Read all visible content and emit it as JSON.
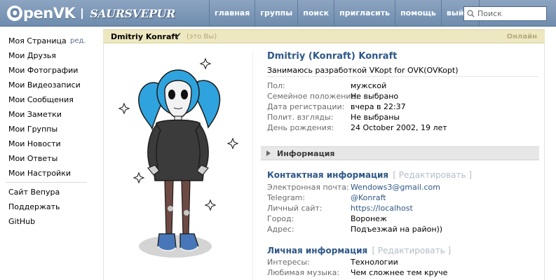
{
  "header": {
    "logo_text": "penVK",
    "logo_o": "O",
    "brand": "SAURSVEPUR",
    "nav": [
      "главная",
      "группы",
      "поиск",
      "пригласить",
      "помощь",
      "выйти"
    ],
    "search_placeholder": "Поиск"
  },
  "sidebar": {
    "items": [
      "Моя Страница",
      "Мои Друзья",
      "Мои Фотографии",
      "Мои Видеозаписи",
      "Мои Сообщения",
      "Мои Заметки",
      "Мои Группы",
      "Мои Новости",
      "Мои Ответы",
      "Мои Настройки"
    ],
    "edit_label": "ред.",
    "extra": [
      "Сайт Вепура",
      "Поддержать",
      "GitHub"
    ]
  },
  "page_header": {
    "name": "Dmitriy Konraft",
    "check": "✔",
    "you": "(это Вы)",
    "online": "Онлайн"
  },
  "profile": {
    "full_name": "Dmitriy (Konraft) Konraft",
    "status": "Занимаюсь разработкой VKopt for OVK(OVKopt)",
    "basic": [
      {
        "label": "Пол:",
        "value": "мужской"
      },
      {
        "label": "Семейное положение:",
        "value": "Не выбрано"
      },
      {
        "label": "Дата регистрации:",
        "value": "вчера в 22:37"
      },
      {
        "label": "Полит. взгляды:",
        "value": "Не выбраны"
      },
      {
        "label": "День рождения:",
        "value": "24 October 2002, 19 лет"
      }
    ],
    "info_section": "Информация",
    "contact_title": "Контактная информация",
    "edit_link": "[ Редактировать ]",
    "contact": [
      {
        "label": "Электронная почта:",
        "value": "Wendows3@gmail.com"
      },
      {
        "label": "Telegram:",
        "value": "@Konraft"
      },
      {
        "label": "Личный сайт:",
        "value": "https://localhost"
      },
      {
        "label": "Город:",
        "value": "Воронеж"
      },
      {
        "label": "Адрес:",
        "value": "Подъезжай на район))"
      }
    ],
    "personal_title": "Личная информация",
    "personal": [
      {
        "label": "Интересы:",
        "value": "Технологии"
      },
      {
        "label": "Любимая музыка:",
        "value": "Чем сложнее тем круче"
      }
    ]
  },
  "colors": {
    "header_bg": "#7b95b6",
    "link": "#2e5787",
    "page_header_bg": "#eee8c0",
    "hair": "#2fa3dd"
  }
}
